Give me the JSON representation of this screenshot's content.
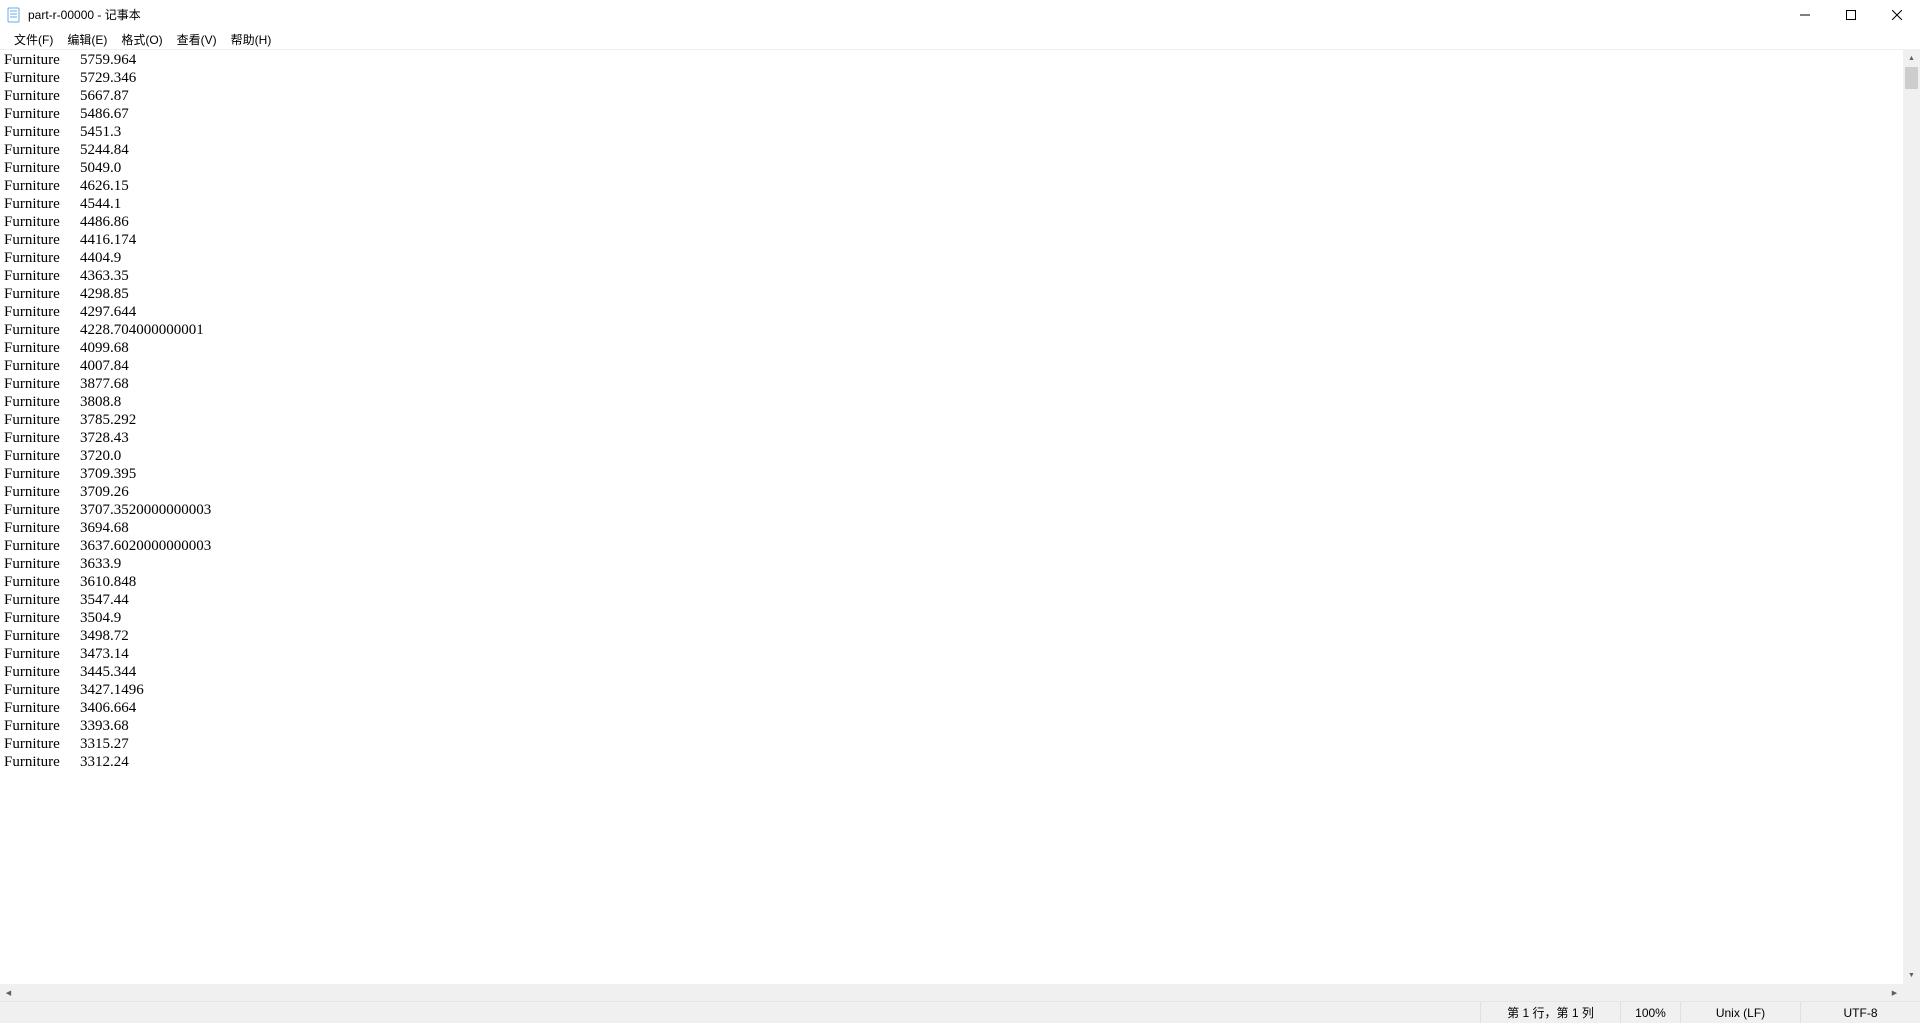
{
  "window": {
    "title": "part-r-00000 - 记事本"
  },
  "menu": {
    "file": "文件(F)",
    "edit": "编辑(E)",
    "format": "格式(O)",
    "view": "查看(V)",
    "help": "帮助(H)"
  },
  "content": {
    "label": "Furniture",
    "rows": [
      {
        "value": "5759.964"
      },
      {
        "value": "5729.346"
      },
      {
        "value": "5667.87"
      },
      {
        "value": "5486.67"
      },
      {
        "value": "5451.3"
      },
      {
        "value": "5244.84"
      },
      {
        "value": "5049.0"
      },
      {
        "value": "4626.15"
      },
      {
        "value": "4544.1"
      },
      {
        "value": "4486.86"
      },
      {
        "value": "4416.174"
      },
      {
        "value": "4404.9"
      },
      {
        "value": "4363.35"
      },
      {
        "value": "4298.85"
      },
      {
        "value": "4297.644"
      },
      {
        "value": "4228.704000000001"
      },
      {
        "value": "4099.68"
      },
      {
        "value": "4007.84"
      },
      {
        "value": "3877.68"
      },
      {
        "value": "3808.8"
      },
      {
        "value": "3785.292"
      },
      {
        "value": "3728.43"
      },
      {
        "value": "3720.0"
      },
      {
        "value": "3709.395"
      },
      {
        "value": "3709.26"
      },
      {
        "value": "3707.3520000000003"
      },
      {
        "value": "3694.68"
      },
      {
        "value": "3637.6020000000003"
      },
      {
        "value": "3633.9"
      },
      {
        "value": "3610.848"
      },
      {
        "value": "3547.44"
      },
      {
        "value": "3504.9"
      },
      {
        "value": "3498.72"
      },
      {
        "value": "3473.14"
      },
      {
        "value": "3445.344"
      },
      {
        "value": "3427.1496"
      },
      {
        "value": "3406.664"
      },
      {
        "value": "3393.68"
      },
      {
        "value": "3315.27"
      },
      {
        "value": "3312.24"
      }
    ]
  },
  "status": {
    "position": "第 1 行，第 1 列",
    "zoom": "100%",
    "line_ending": "Unix (LF)",
    "encoding": "UTF-8"
  }
}
